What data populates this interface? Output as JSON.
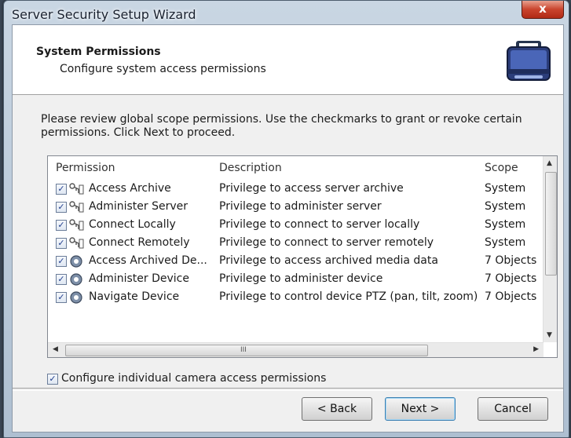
{
  "window": {
    "title": "Server Security Setup Wizard",
    "close_glyph": "x"
  },
  "header": {
    "title": "System Permissions",
    "subtitle": "Configure system access permissions",
    "icon": "briefcase-icon"
  },
  "instructions": "Please review global scope permissions. Use the checkmarks to grant or revoke certain permissions. Click Next to proceed.",
  "permissions_list": {
    "columns": [
      "Permission",
      "Description",
      "Scope"
    ],
    "rows": [
      {
        "checked": true,
        "icon": "key-icon",
        "permission": "Access Archive",
        "description": "Privilege to access server archive",
        "scope": "System"
      },
      {
        "checked": true,
        "icon": "key-icon",
        "permission": "Administer Server",
        "description": "Privilege to administer server",
        "scope": "System"
      },
      {
        "checked": true,
        "icon": "key-icon",
        "permission": "Connect Locally",
        "description": "Privilege to connect to server locally",
        "scope": "System"
      },
      {
        "checked": true,
        "icon": "key-icon",
        "permission": "Connect Remotely",
        "description": "Privilege to connect to server remotely",
        "scope": "System"
      },
      {
        "checked": true,
        "icon": "gear-icon",
        "permission": "Access Archived De...",
        "description": "Privilege to access archived media data",
        "scope": "7 Objects"
      },
      {
        "checked": true,
        "icon": "gear-icon",
        "permission": "Administer Device",
        "description": "Privilege to administer device",
        "scope": "7 Objects"
      },
      {
        "checked": true,
        "icon": "gear-icon",
        "permission": "Navigate Device",
        "description": "Privilege to control device PTZ (pan, tilt, zoom)",
        "scope": "7 Objects"
      }
    ],
    "scroll_grip": "III"
  },
  "camera_option": {
    "checked": true,
    "label": "Configure individual camera access permissions"
  },
  "buttons": {
    "back": "< Back",
    "next": "Next >",
    "cancel": "Cancel"
  },
  "colors": {
    "title_bar": "#c9d6e3",
    "close_button": "#c9442d",
    "client": "#f0f0f0",
    "header": "#ffffff"
  }
}
